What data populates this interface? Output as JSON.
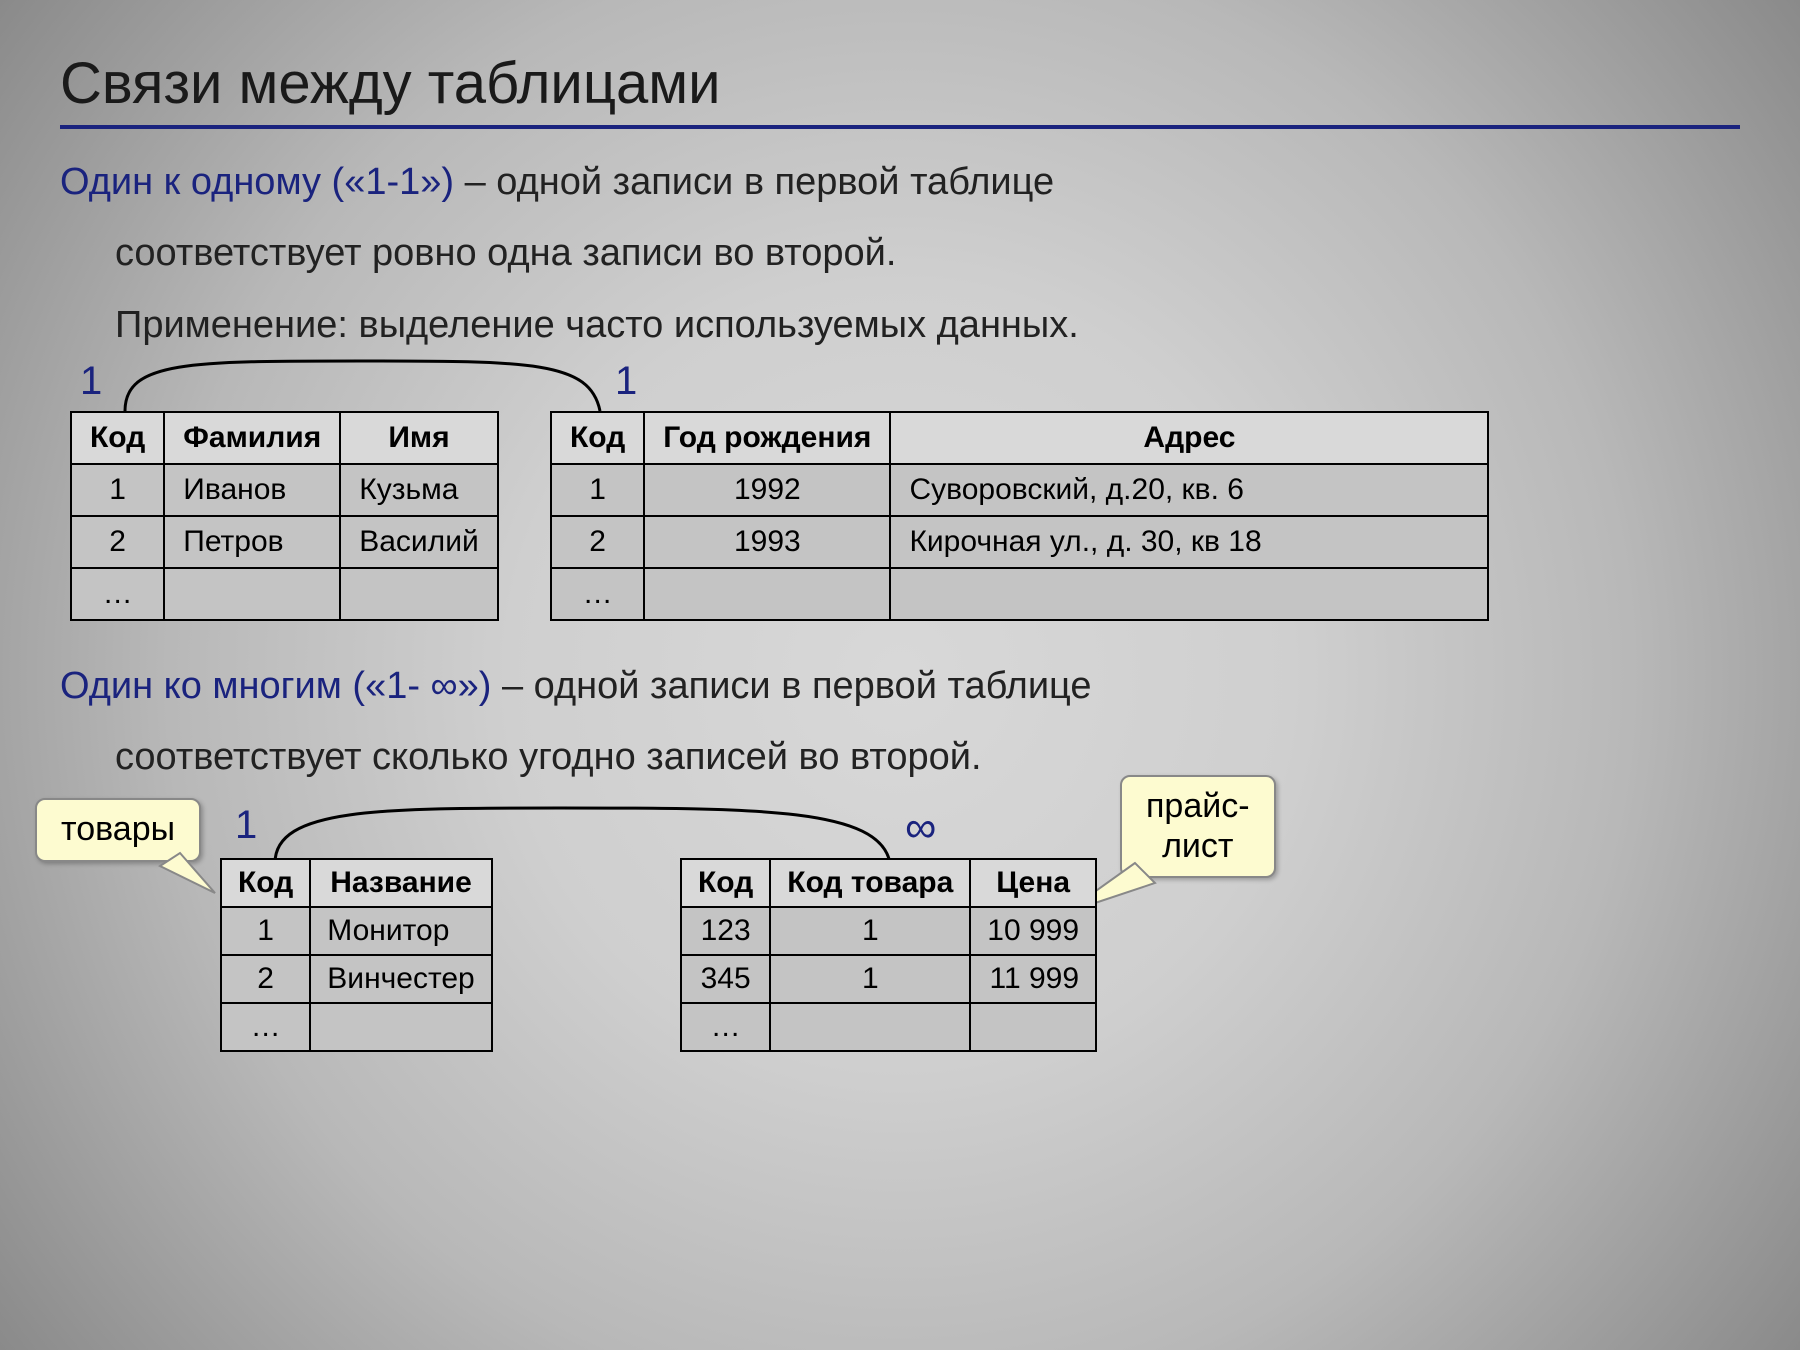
{
  "title": "Связи между таблицами",
  "s1": {
    "lead": "Один к одному («1-1»)",
    "rest": " – одной записи в первой таблице",
    "line2": "соответствует ровно одна записи во второй.",
    "line3": "Применение: выделение часто используемых данных.",
    "left_label": "1",
    "right_label": "1",
    "tableA": {
      "headers": [
        "Код",
        "Фамилия",
        "Имя"
      ],
      "rows": [
        [
          "1",
          "Иванов",
          "Кузьма"
        ],
        [
          "2",
          "Петров",
          "Василий"
        ],
        [
          "…",
          "",
          ""
        ]
      ]
    },
    "tableB": {
      "headers": [
        "Код",
        "Год рождения",
        "Адрес"
      ],
      "rows": [
        [
          "1",
          "1992",
          "Суворовский, д.20, кв. 6"
        ],
        [
          "2",
          "1993",
          "Кирочная ул., д. 30, кв 18"
        ],
        [
          "…",
          "",
          ""
        ]
      ]
    }
  },
  "s2": {
    "lead": "Один ко многим («1- ∞»)",
    "rest": " – одной записи в первой таблице",
    "line2": "соответствует сколько угодно записей во второй.",
    "left_label": "1",
    "right_label": "∞",
    "callout_left": "товары",
    "callout_right": "прайс-\nлист",
    "tableA": {
      "headers": [
        "Код",
        "Название"
      ],
      "rows": [
        [
          "1",
          "Монитор"
        ],
        [
          "2",
          "Винчестер"
        ],
        [
          "…",
          ""
        ]
      ]
    },
    "tableB": {
      "headers": [
        "Код",
        "Код товара",
        "Цена"
      ],
      "rows": [
        [
          "123",
          "1",
          "10 999"
        ],
        [
          "345",
          "1",
          "11 999"
        ],
        [
          "…",
          "",
          ""
        ]
      ]
    }
  }
}
